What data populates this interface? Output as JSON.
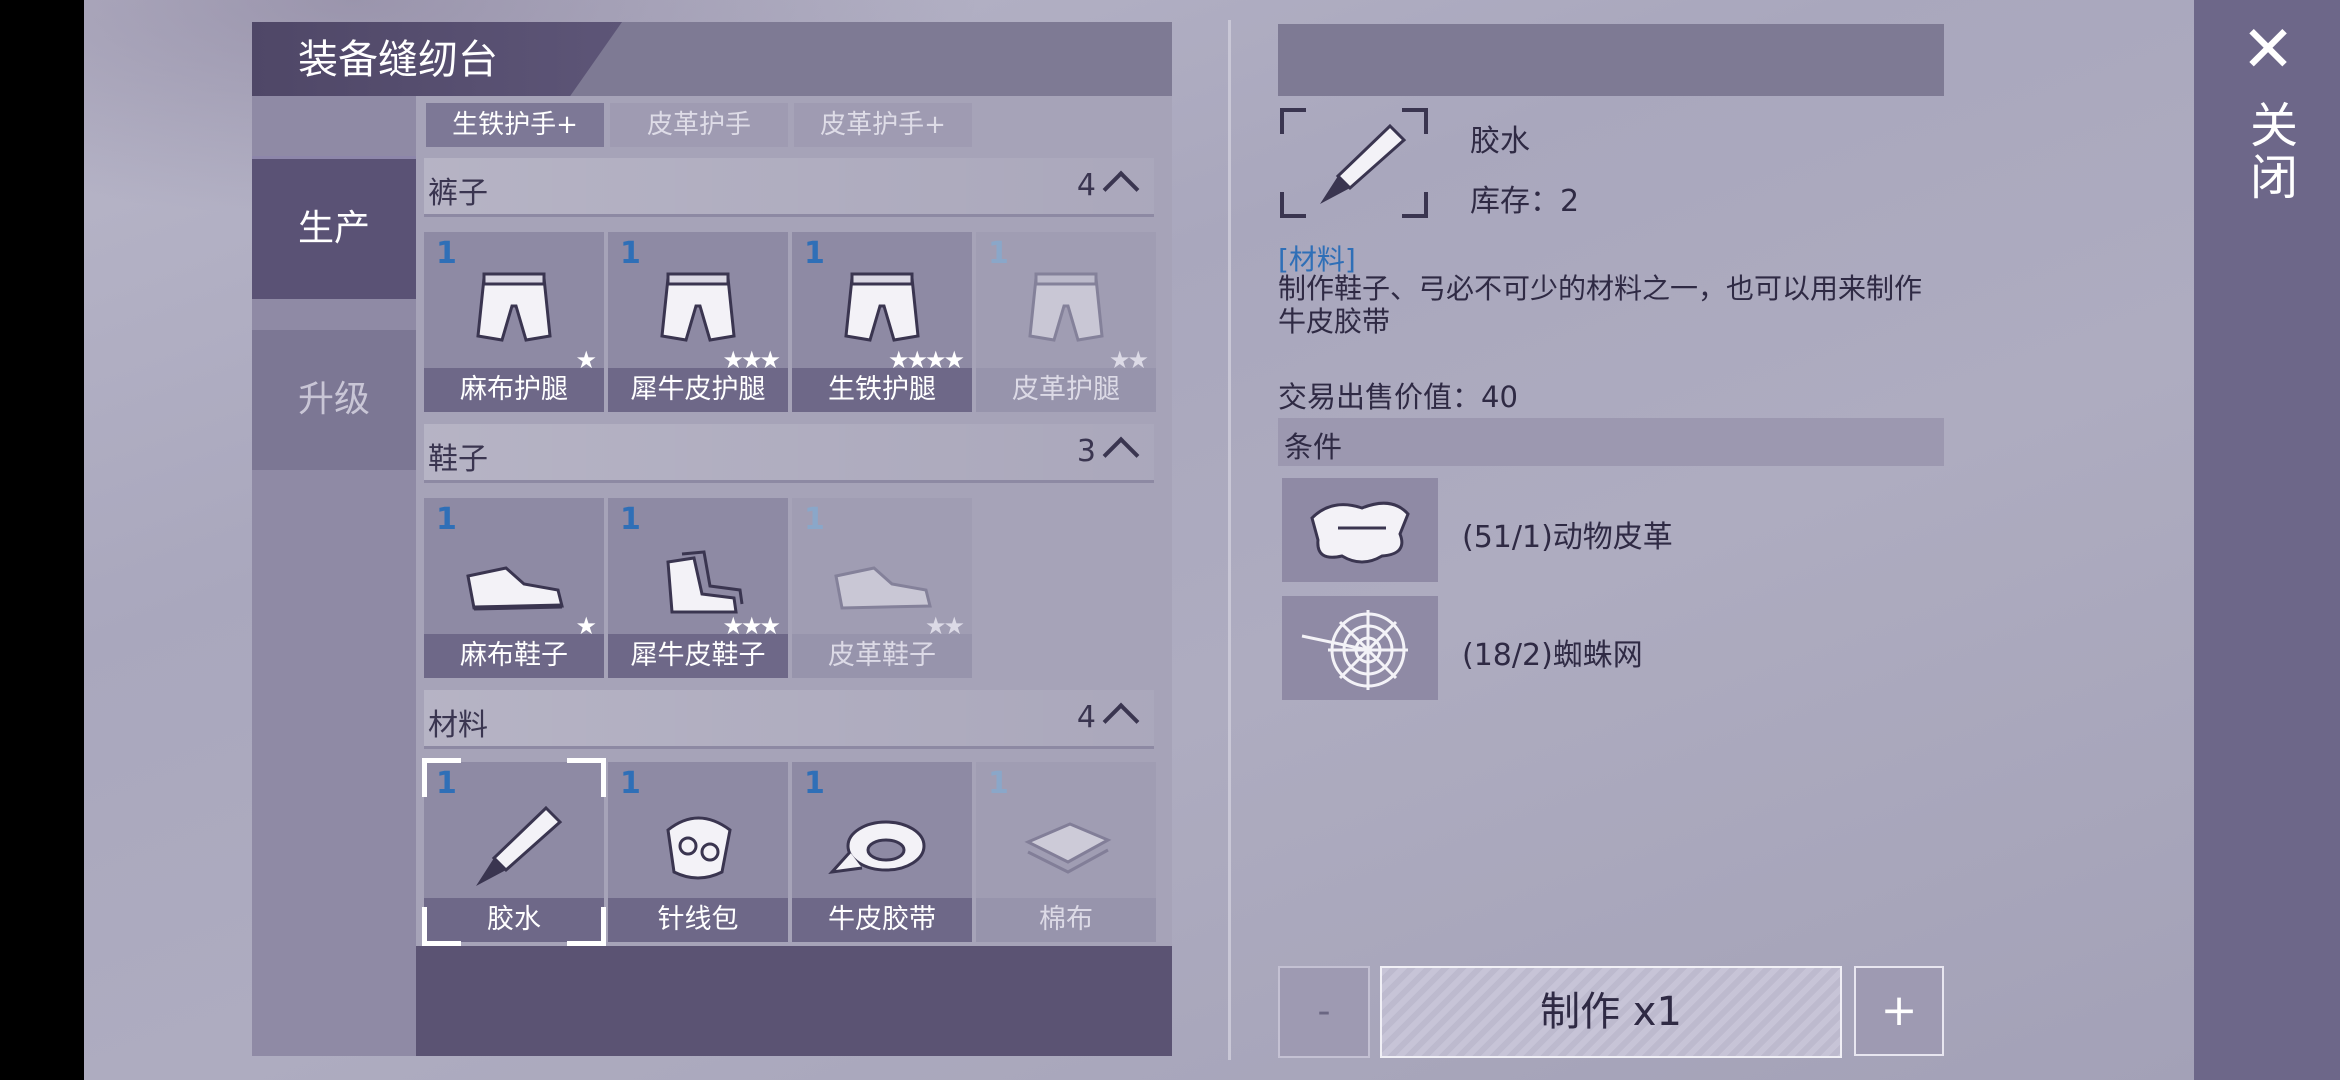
{
  "window": {
    "title": "装备缝纫台",
    "close_label": "关闭",
    "close_icon": "close-icon"
  },
  "sidebar": {
    "items": [
      {
        "label": "生产",
        "active": true
      },
      {
        "label": "升级",
        "active": false
      }
    ]
  },
  "subtabs": [
    {
      "label": "生铁护手+"
    },
    {
      "label": "皮革护手"
    },
    {
      "label": "皮革护手+"
    }
  ],
  "categories": [
    {
      "name": "裤子",
      "count": "4",
      "items": [
        {
          "qty": "1",
          "name": "麻布护腿",
          "stars": "★",
          "icon": "pants-icon"
        },
        {
          "qty": "1",
          "name": "犀牛皮护腿",
          "stars": "★★★",
          "icon": "pants-icon"
        },
        {
          "qty": "1",
          "name": "生铁护腿",
          "stars": "★★★★",
          "icon": "pants-icon"
        },
        {
          "qty": "1",
          "name": "皮革护腿",
          "stars": "★★",
          "icon": "pants-icon"
        }
      ]
    },
    {
      "name": "鞋子",
      "count": "3",
      "items": [
        {
          "qty": "1",
          "name": "麻布鞋子",
          "stars": "★",
          "icon": "shoes-icon"
        },
        {
          "qty": "1",
          "name": "犀牛皮鞋子",
          "stars": "★★★",
          "icon": "shoes-icon"
        },
        {
          "qty": "1",
          "name": "皮革鞋子",
          "stars": "★★",
          "icon": "shoes-icon"
        }
      ]
    },
    {
      "name": "材料",
      "count": "4",
      "items": [
        {
          "qty": "1",
          "name": "胶水",
          "stars": "",
          "icon": "glue-icon"
        },
        {
          "qty": "1",
          "name": "针线包",
          "stars": "",
          "icon": "sewing-kit-icon"
        },
        {
          "qty": "1",
          "name": "牛皮胶带",
          "stars": "",
          "icon": "tape-icon"
        },
        {
          "qty": "1",
          "name": "棉布",
          "stars": "",
          "icon": "cloth-icon"
        }
      ]
    }
  ],
  "detail": {
    "name": "胶水",
    "stock": "库存：2",
    "tag": "[材料]",
    "description": "制作鞋子、弓必不可少的材料之一，也可以用来制作牛皮胶带",
    "price": "交易出售价值：40",
    "conditions_label": "条件",
    "requirements": [
      {
        "text": "(51/1)动物皮革",
        "icon": "animal-hide-icon"
      },
      {
        "text": "(18/2)蜘蛛网",
        "icon": "spider-web-icon"
      }
    ]
  },
  "actions": {
    "minus": "-",
    "make": "制作 x1",
    "plus": "+"
  }
}
